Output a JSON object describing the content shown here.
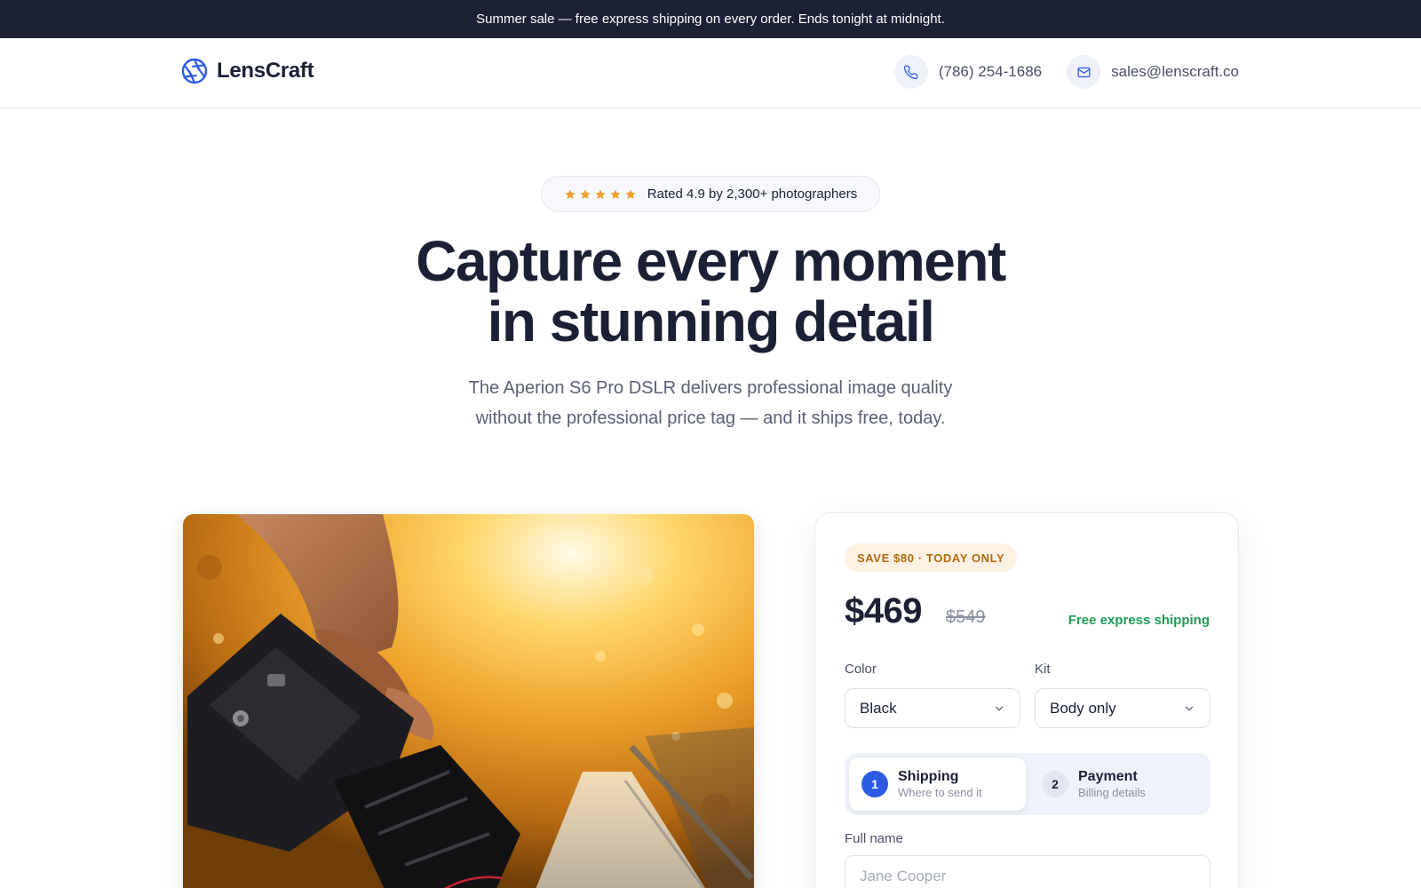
{
  "announcement": "Summer sale — free express shipping on every order. Ends tonight at midnight.",
  "brand": {
    "name": "LensCraft",
    "logo_icon": "aperture-icon",
    "color": "#2d5be3"
  },
  "contact": {
    "phone": "(786) 254-1686",
    "phone_icon": "phone-icon",
    "email": "sales@lenscraft.co",
    "email_icon": "mail-icon"
  },
  "rating": {
    "stars": 5,
    "text": "Rated 4.9 by 2,300+ photographers",
    "star_color": "#f0a030"
  },
  "hero": {
    "title_lines": [
      "Capture every moment",
      "in stunning detail"
    ],
    "subtitle_lines": [
      "The Aperion S6 Pro DSLR delivers professional image quality",
      "without the professional price tag — and it ships free, today."
    ]
  },
  "product_image": {
    "icon": "camera-photo"
  },
  "offer": {
    "badge": "SAVE $80 · TODAY ONLY",
    "price": "$469",
    "old_price": "$549",
    "shipping_note": "Free express shipping",
    "shipping_color": "#1f9d55"
  },
  "options": {
    "color": {
      "label": "Color",
      "value": "Black"
    },
    "kit": {
      "label": "Kit",
      "value": "Body only"
    }
  },
  "steps": [
    {
      "number": "1",
      "title": "Shipping",
      "subtitle": "Where to send it",
      "active": true
    },
    {
      "number": "2",
      "title": "Payment",
      "subtitle": "Billing details",
      "active": false
    }
  ],
  "form": {
    "full_name_label": "Full name",
    "full_name_placeholder": "Jane Cooper",
    "full_name_value": ""
  }
}
